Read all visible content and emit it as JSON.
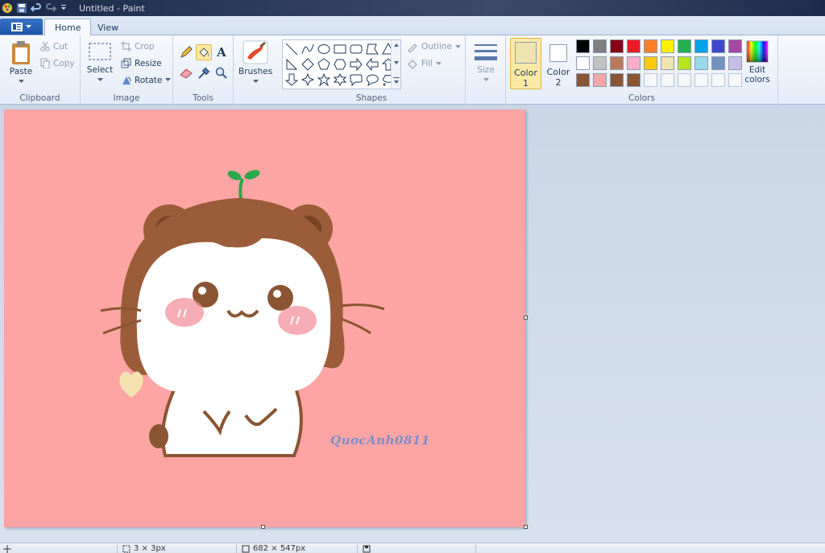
{
  "window": {
    "title": "Untitled - Paint"
  },
  "tabs": {
    "menu_icon": "app-menu-icon",
    "home": "Home",
    "view": "View"
  },
  "clipboard": {
    "paste": "Paste",
    "cut": "Cut",
    "copy": "Copy",
    "label": "Clipboard"
  },
  "image": {
    "select": "Select",
    "crop": "Crop",
    "resize": "Resize",
    "rotate": "Rotate",
    "label": "Image"
  },
  "tools": {
    "label": "Tools",
    "text_glyph": "A"
  },
  "brushes": {
    "label": "Brushes"
  },
  "shapes": {
    "outline": "Outline",
    "fill": "Fill",
    "label": "Shapes"
  },
  "size": {
    "label": "Size"
  },
  "colors": {
    "color1_label": "Color",
    "color1_num": "1",
    "color2_label": "Color",
    "color2_num": "2",
    "edit_label": "Edit",
    "edit_label2": "colors",
    "label": "Colors",
    "color1": "#efe4b0",
    "color2": "#ffffff",
    "palette_row1": [
      "#000000",
      "#7f7f7f",
      "#880015",
      "#ed1c24",
      "#ff7f27",
      "#fff200",
      "#22b14c",
      "#00a2e8",
      "#3f48cc",
      "#a349a4"
    ],
    "palette_row2": [
      "#ffffff",
      "#c3c3c3",
      "#b97a57",
      "#ffaec9",
      "#ffc90e",
      "#efe4b0",
      "#b5e61d",
      "#99d9ea",
      "#7092be",
      "#c8bfe7"
    ],
    "palette_row3": [
      "#8a5533",
      "#f3a7a7",
      "#8a5533",
      "#8a5533",
      "",
      "",
      "",
      "",
      "",
      ""
    ]
  },
  "canvas": {
    "background": "#fda4a4",
    "watermark": "QuocAnh0811"
  },
  "status": {
    "selection": "3 × 3px",
    "image_size": "682 × 547px"
  }
}
